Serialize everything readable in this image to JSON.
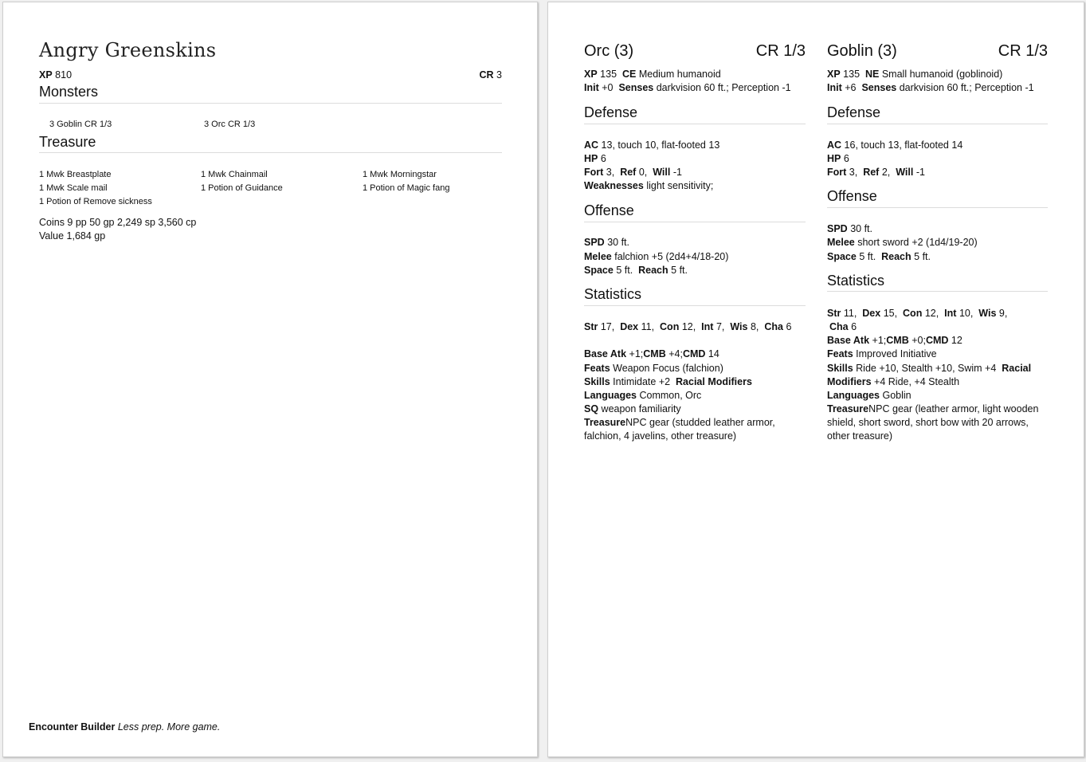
{
  "encounter": {
    "title": "Angry Greenskins",
    "xp_label": "XP",
    "xp_value": "810",
    "cr_label": "CR",
    "cr_value": "3",
    "monsters_heading": "Monsters",
    "monsters": [
      "3 Goblin CR 1/3",
      "3 Orc CR 1/3"
    ],
    "treasure_heading": "Treasure",
    "treasure_items": [
      "1 Mwk Breastplate",
      "1 Mwk Chainmail",
      "1 Mwk Morningstar",
      "1 Mwk Scale mail",
      "1 Potion of Guidance",
      "1 Potion of Magic fang",
      "1 Potion of Remove sickness"
    ],
    "coins": "Coins 9 pp 50 gp 2,249 sp 3,560 cp",
    "value": "Value 1,684 gp"
  },
  "footer": {
    "brand": "Encounter Builder",
    "tagline": "Less prep. More game."
  },
  "orc": {
    "name": "Orc (3)",
    "cr": "CR 1/3",
    "xp": "135",
    "alignment": "CE",
    "type": "Medium humanoid",
    "init": "+0",
    "senses": "darkvision 60 ft.; Perception -1",
    "defense_heading": "Defense",
    "ac": "13, touch 10, flat-footed 13",
    "hp": "6",
    "fort": "3,",
    "ref": "0,",
    "will": "-1",
    "weaknesses": "light sensitivity;",
    "offense_heading": "Offense",
    "spd": "30 ft.",
    "melee": "falchion +5 (2d4+4/18-20)",
    "space": "5 ft.",
    "reach": "5 ft.",
    "statistics_heading": "Statistics",
    "str": "17,",
    "dex": "11,",
    "con": "12,",
    "int": "7,",
    "wis": "8,",
    "cha": "6",
    "base_atk": "+1;",
    "cmb": "+4;",
    "cmd": "14",
    "feats": "Weapon Focus (falchion)",
    "skills": "Intimidate +2",
    "racial_modifiers_label": "Racial Modifiers",
    "languages": "Common, Orc",
    "sq": "weapon familiarity",
    "treasure_line1": "NPC gear (studded leather armor,",
    "treasure_line2": "falchion, 4 javelins, other treasure)"
  },
  "goblin": {
    "name": "Goblin (3)",
    "cr": "CR 1/3",
    "xp": "135",
    "alignment": "NE",
    "type": "Small humanoid (goblinoid)",
    "init": "+6",
    "senses": "darkvision 60 ft.; Perception -1",
    "defense_heading": "Defense",
    "ac": "16, touch 13, flat-footed 14",
    "hp": "6",
    "fort": "3,",
    "ref": "2,",
    "will": "-1",
    "offense_heading": "Offense",
    "spd": "30 ft.",
    "melee": "short sword +2 (1d4/19-20)",
    "space": "5 ft.",
    "reach": "5 ft.",
    "statistics_heading": "Statistics",
    "str": "11,",
    "dex": "15,",
    "con": "12,",
    "int": "10,",
    "wis": "9,",
    "cha": "6",
    "base_atk": "+1;",
    "cmb": "+0;",
    "cmd": "12",
    "feats": "Improved Initiative",
    "skills": "Ride +10, Stealth +10, Swim +4",
    "racial_modifiers_label": "Racial",
    "racial_modifiers_label2": "Modifiers",
    "racial_modifiers": "+4 Ride, +4 Stealth",
    "languages": "Goblin",
    "treasure_line1": "NPC gear (leather armor, light wooden",
    "treasure_line2": "shield, short sword, short bow with 20 arrows,",
    "treasure_line3": "other treasure)"
  }
}
